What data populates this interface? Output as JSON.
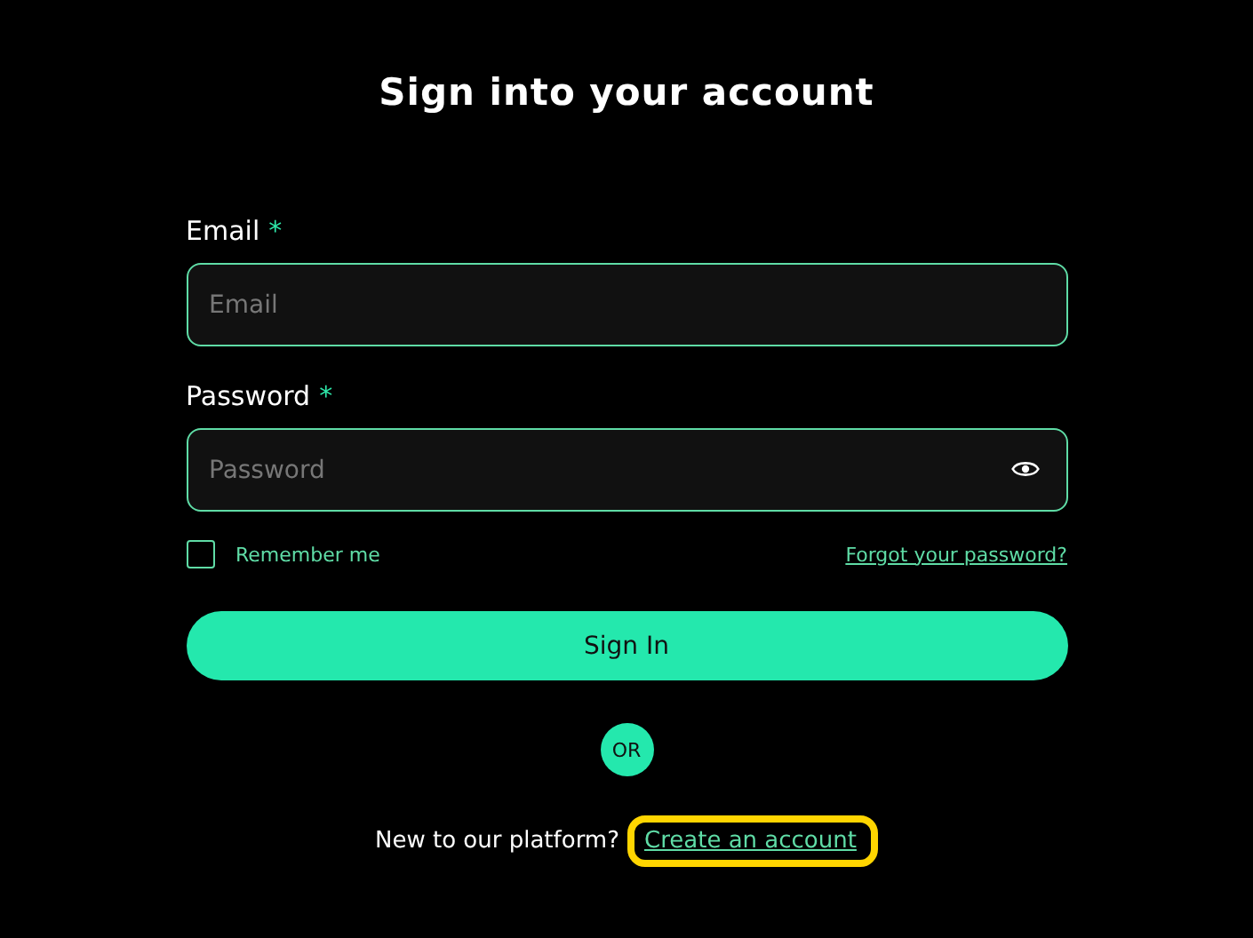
{
  "title": "Sign into your account",
  "fields": [
    {
      "label": "Email",
      "required_mark": "*",
      "placeholder": "Email",
      "kind": "text"
    },
    {
      "label": "Password",
      "required_mark": "*",
      "placeholder": "Password",
      "kind": "password"
    }
  ],
  "remember": {
    "label": "Remember me",
    "checked": false
  },
  "forgot_link": "Forgot your password?",
  "submit": "Sign In",
  "divider": "OR",
  "signup": {
    "prompt": "New to our platform?",
    "link": "Create an account",
    "highlighted": true
  }
}
